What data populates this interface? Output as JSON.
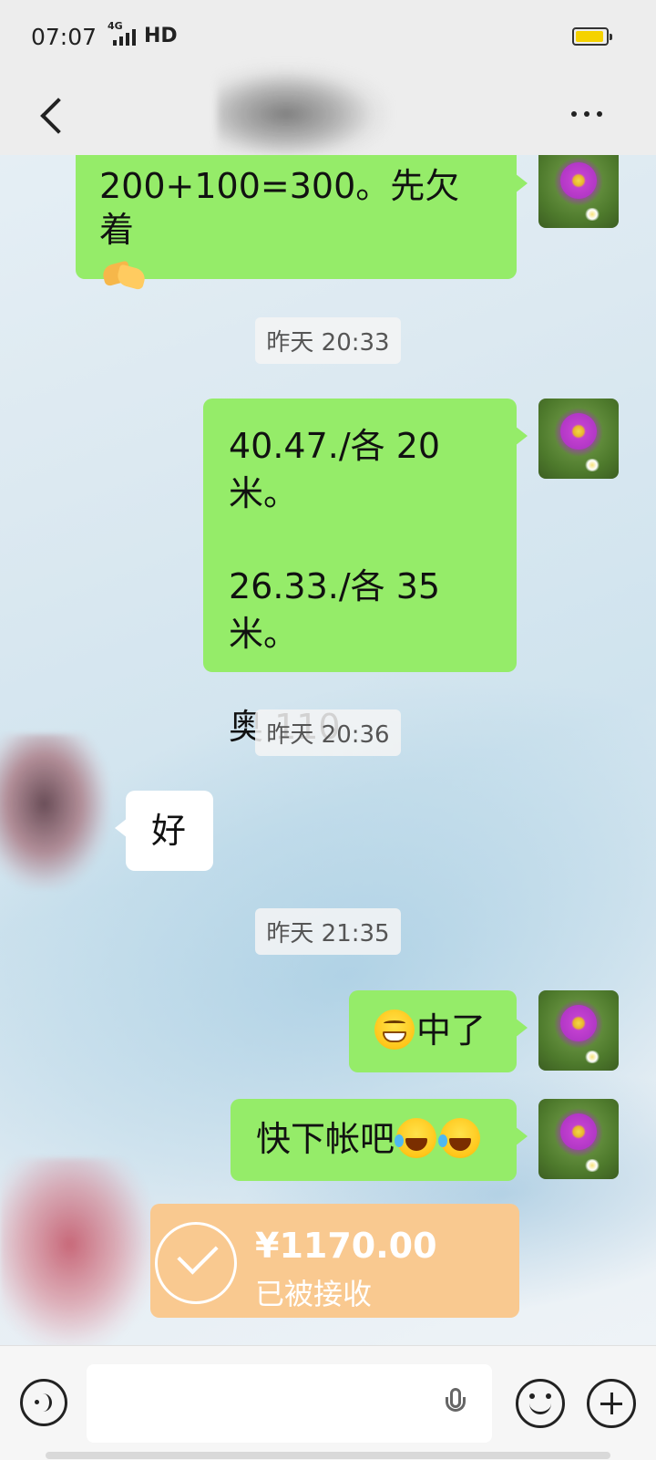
{
  "status_bar": {
    "time": "07:07",
    "network": "4G",
    "hd": "HD"
  },
  "header": {
    "contact_name": "",
    "back_icon": "chevron-left-icon",
    "more_icon": "more-horizontal-icon"
  },
  "messages": [
    {
      "side": "right",
      "text": "200+100=300。先欠着",
      "emoji": "handshake"
    },
    {
      "type": "timestamp",
      "text": "昨天 20:33"
    },
    {
      "side": "right",
      "lines": [
        "40.47./各 20 米。",
        "26.33./各 35 米。",
        "奥 110"
      ]
    },
    {
      "type": "timestamp",
      "text": "昨天 20:36"
    },
    {
      "side": "left",
      "text": "好"
    },
    {
      "type": "timestamp",
      "text": "昨天 21:35"
    },
    {
      "side": "right",
      "emoji": "grin",
      "text": "中了"
    },
    {
      "side": "right",
      "text": "快下帐吧",
      "emoji": "laugh-cry x2"
    },
    {
      "side": "right",
      "type": "transfer",
      "amount": "¥1170.00",
      "status": "已被接收"
    }
  ],
  "input_bar": {
    "placeholder": "",
    "voice_icon": "voice-icon",
    "mic_icon": "mic-icon",
    "emoji_icon": "emoji-icon",
    "plus_icon": "plus-icon"
  },
  "colors": {
    "bubble_self": "#95ec69",
    "bubble_other": "#ffffff",
    "transfer_card": "#f9c990",
    "header_bg": "#ededed"
  }
}
